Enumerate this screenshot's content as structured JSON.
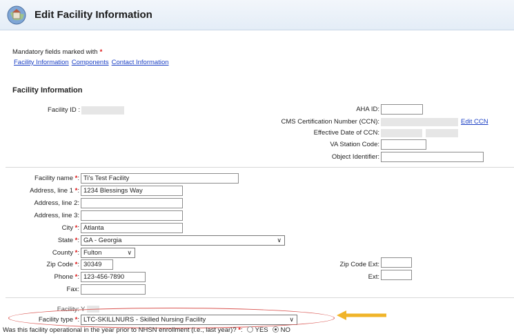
{
  "header": {
    "title": "Edit Facility Information"
  },
  "mandatory": {
    "text": "Mandatory fields marked with",
    "star": "*"
  },
  "nav_links": [
    "Facility Information",
    "Components",
    "Contact Information"
  ],
  "section_title": "Facility Information",
  "top_fields": {
    "facility_id_label": "Facility ID :",
    "aha_label": "AHA ID:",
    "ccn_label": "CMS Certification Number (CCN):",
    "edit_ccn": "Edit CCN",
    "ccn_date_label": "Effective Date of CCN:",
    "va_label": "VA Station Code:",
    "oid_label": "Object Identifier:"
  },
  "address": {
    "facility_name_label": "Facility name",
    "facility_name": "Ti's Test Facility",
    "addr1_label": "Address, line 1",
    "addr1": "1234 Blessings Way",
    "addr2_label": "Address, line 2:",
    "addr3_label": "Address, line 3:",
    "city_label": "City",
    "city": "Atlanta",
    "state_label": "State",
    "state": "GA - Georgia",
    "county_label": "County",
    "county": "Fulton",
    "zip_label": "Zip Code",
    "zip": "30349",
    "zip_ext_label": "Zip Code Ext:",
    "phone_label": "Phone",
    "phone": "123-456-7890",
    "ext_label": "Ext:",
    "fax_label": "Fax:"
  },
  "facility": {
    "facility_label": "Facility:",
    "facility_value": "Y",
    "type_label": "Facility type",
    "type_value": "LTC-SKILLNURS - Skilled Nursing Facility",
    "question": "Was this facility operational in the year prior to NHSN enrollment (i.e., last year)?",
    "yes": "YES",
    "no": "NO"
  },
  "colors": {
    "required": "#dd1111",
    "link": "#1a3fc4",
    "highlight": "#d9534f",
    "arrow": "#f0b429"
  }
}
